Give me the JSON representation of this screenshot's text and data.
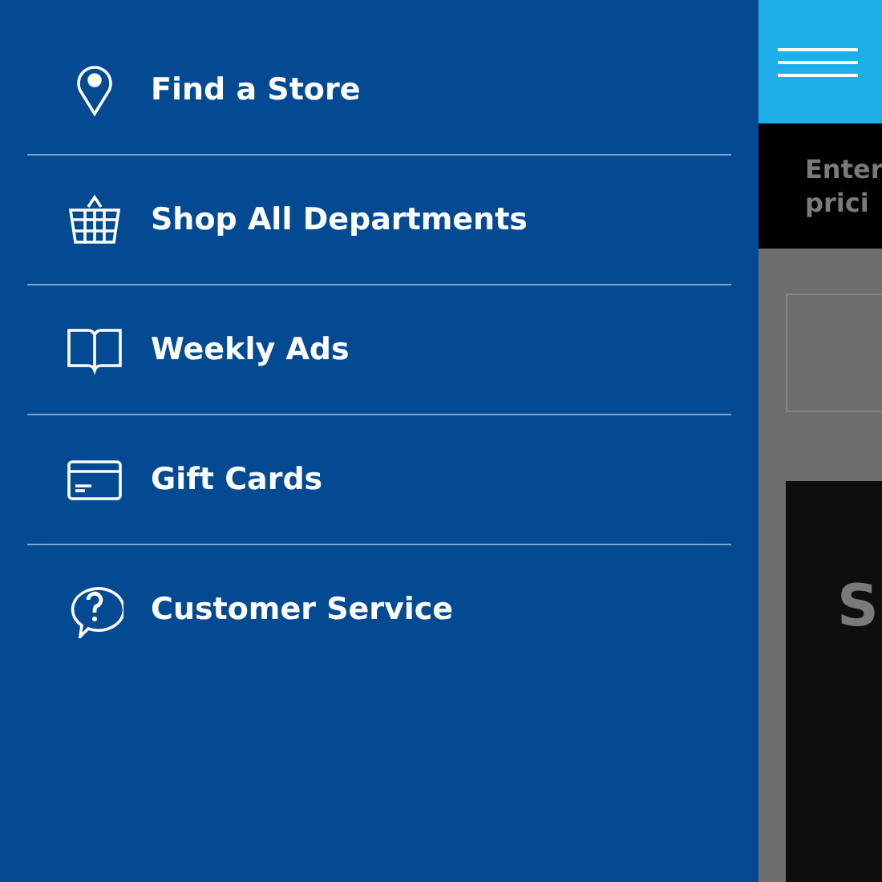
{
  "menu": [
    {
      "kind": "pin",
      "label": "Find a Store"
    },
    {
      "kind": "basket",
      "label": "Shop All Departments"
    },
    {
      "kind": "book",
      "label": "Weekly Ads"
    },
    {
      "kind": "card",
      "label": "Gift Cards"
    },
    {
      "kind": "help",
      "label": "Customer Service"
    }
  ],
  "banner": {
    "lines": [
      "Enter",
      "prici"
    ]
  },
  "promo": {
    "text": "S"
  }
}
